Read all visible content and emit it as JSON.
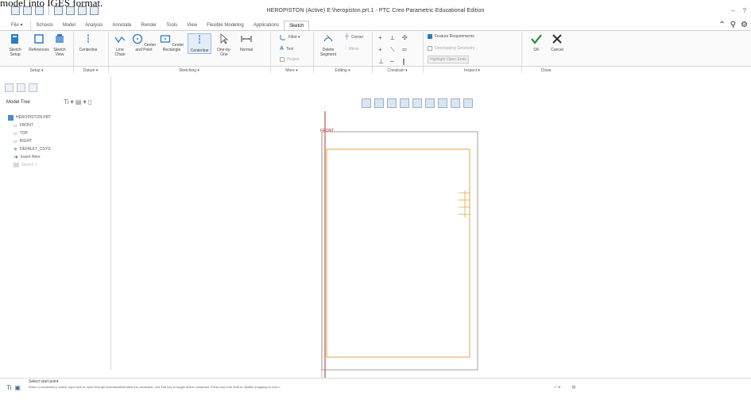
{
  "caption_fragment": "model into IGES format.",
  "window": {
    "title": "HEROPISTON (Active) E:\\heropiston.prt.1 - PTC Creo Parametric Educational Edition"
  },
  "ribbon_tabs": [
    {
      "label": "File ▾"
    },
    {
      "label": "Schools"
    },
    {
      "label": "Model"
    },
    {
      "label": "Analysis"
    },
    {
      "label": "Annotate"
    },
    {
      "label": "Render"
    },
    {
      "label": "Tools"
    },
    {
      "label": "View"
    },
    {
      "label": "Flexible Modeling"
    },
    {
      "label": "Applications"
    },
    {
      "label": "Sketch"
    }
  ],
  "ribbon": {
    "sketch_setup": "Sketch Setup",
    "references": "References",
    "sketch_view": "Sketch View",
    "centerline": "Centerline",
    "line_chain": "Line Chain",
    "center_and_point": "Center and Point",
    "center_rectangle": "Center Rectangle",
    "centerline2": "Centerline",
    "one_by_one": "One-by-One",
    "normal": "Normal",
    "fillet": "Fillet ▾",
    "text": "Text",
    "project": "Project",
    "delete_segment": "Delete Segment",
    "corner": "Corner",
    "mirror": "Mirror",
    "feature_requirements": "Feature Requirements",
    "overlapping_geometry": "Overlapping Geometry",
    "highlight_open_ends": "Highlight Open Ends",
    "ok": "OK",
    "cancel": "Cancel"
  },
  "groups": {
    "setup": "Setup ▾",
    "datum": "Datum ▾",
    "sketching": "Sketching ▾",
    "more": "More ▾",
    "editing": "Editing ▾",
    "constrain": "Constrain ▾",
    "inspect": "Inspect ▾",
    "close": "Close"
  },
  "model_tree": {
    "header": "Model Tree",
    "items": [
      {
        "label": "HEROPISTON.PRT"
      },
      {
        "label": "FRONT"
      },
      {
        "label": "TOP"
      },
      {
        "label": "RIGHT"
      },
      {
        "label": "DEFAULT_CSYS"
      },
      {
        "label": "Insert Here"
      },
      {
        "label": "Sketch 1"
      }
    ]
  },
  "graphics": {
    "datum_label": "FRONT"
  },
  "status": {
    "line1": "Select start point.",
    "line2": "When a constraint is active, right click to cycle through lock/disable/enable the constraint. Use Tab key to toggle active constraint. Press and hold Shift to disable snapping to new c"
  },
  "colors": {
    "sketch": "#e2a54a",
    "datum": "#b0332e",
    "ok_green": "#2e8b2e",
    "ribbon_blue": "#1f6fb5"
  }
}
